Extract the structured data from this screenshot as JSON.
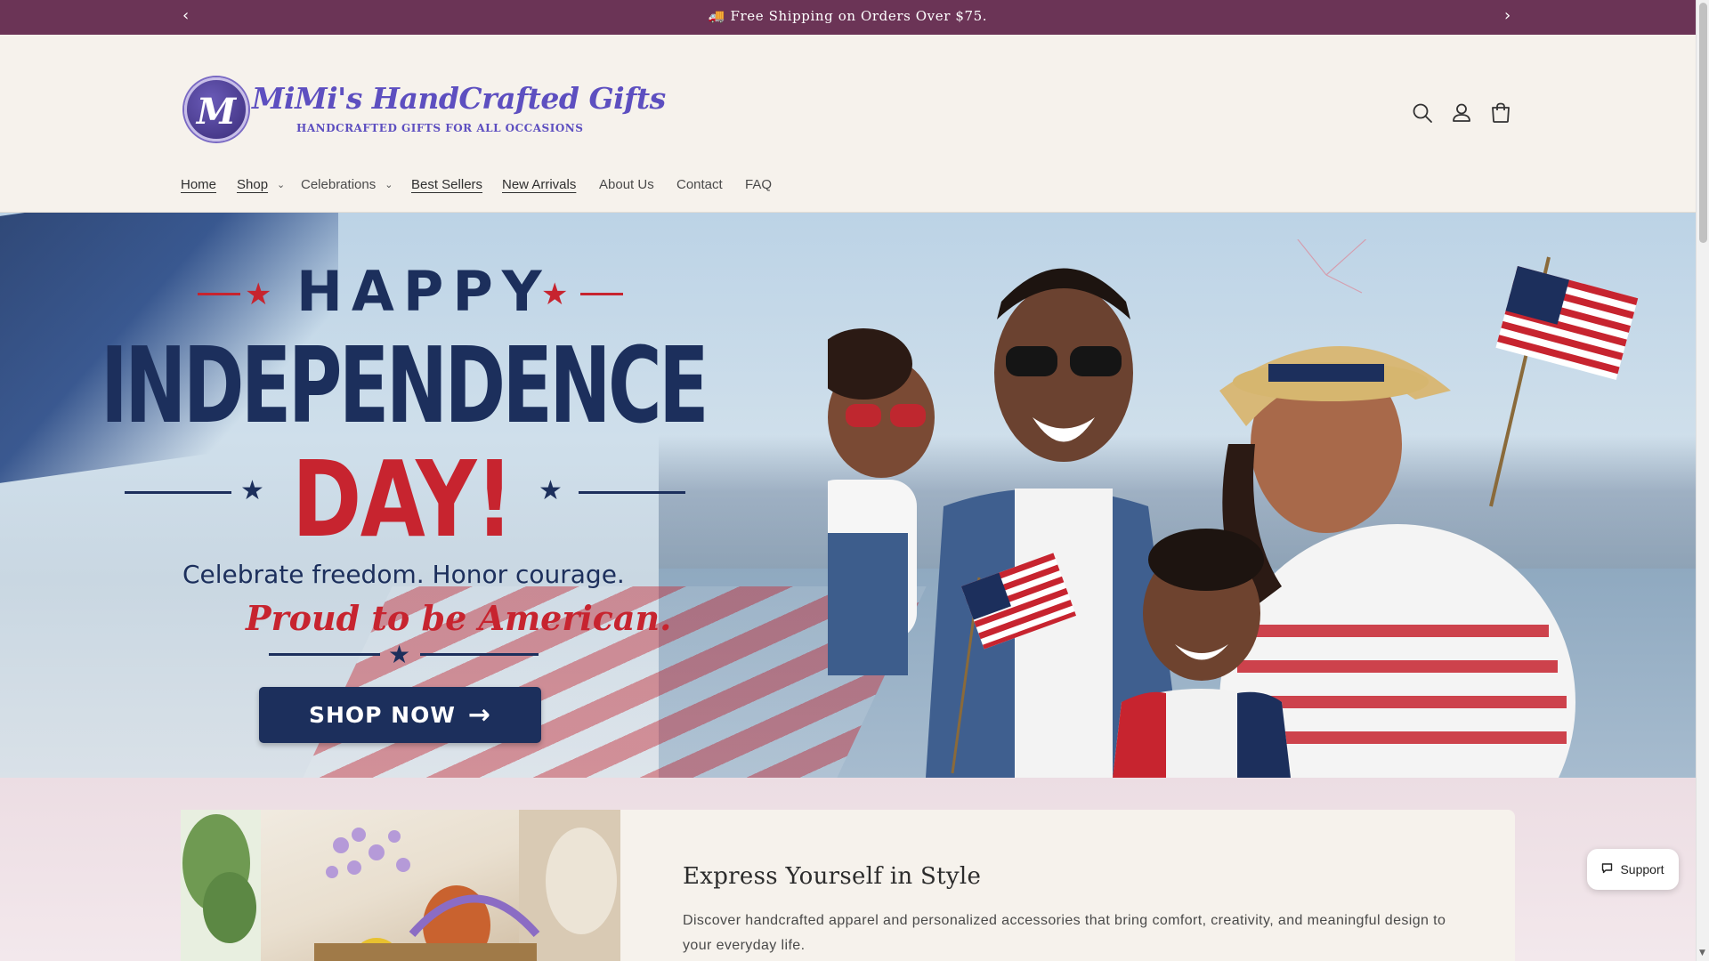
{
  "announcement": {
    "text": "🚚 Free Shipping on Orders Over $75.",
    "prev_icon": "chevron-left-icon",
    "next_icon": "chevron-right-icon"
  },
  "header": {
    "logo": {
      "monogram": "M",
      "name": "MiMi's HandCrafted Gifts",
      "tagline": "HANDCRAFTED GIFTS FOR ALL OCCASIONS"
    },
    "icons": [
      "search-icon",
      "account-icon",
      "cart-icon"
    ]
  },
  "nav": {
    "items": [
      {
        "label": "Home",
        "underlined": true
      },
      {
        "label": "Shop",
        "underlined": true,
        "dropdown": true
      },
      {
        "label": "Celebrations",
        "underlined": false,
        "dropdown": true
      },
      {
        "label": "Best Sellers",
        "underlined": true
      },
      {
        "label": "New Arrivals",
        "underlined": true
      },
      {
        "label": "About Us",
        "underlined": false
      },
      {
        "label": "Contact",
        "underlined": false
      },
      {
        "label": "FAQ",
        "underlined": false
      }
    ]
  },
  "hero": {
    "line1": "HAPPY",
    "line2": "INDEPENDENCE",
    "line3": "DAY!",
    "subtitle": "Celebrate freedom. Honor courage.",
    "script": "Proud to be American.",
    "cta": "SHOP NOW",
    "colors": {
      "navy": "#1c2f5c",
      "red": "#c7242f"
    }
  },
  "feature": {
    "title": "Express Yourself in Style",
    "description": "Discover handcrafted apparel and personalized accessories that bring comfort, creativity, and meaningful design to your everyday life."
  },
  "support": {
    "label": "Support",
    "icon": "chat-bubble-icon"
  },
  "colors": {
    "announcement_bg": "#6b3456",
    "page_bg": "#f6f2ec",
    "brand_purple": "#5d4fc0"
  }
}
